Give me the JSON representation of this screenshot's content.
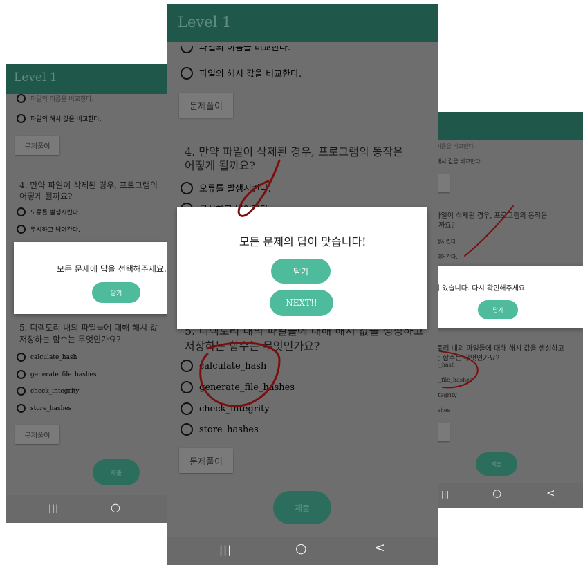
{
  "level_title": "Level 1",
  "options_prev": {
    "prev_a": "파일의 이름을 비교한다.",
    "prev_b": "파일의 해시 값을 비교한다."
  },
  "solve_label": "문제풀이",
  "q4": {
    "text_line1": "4. 만약 파일이 삭제된 경우, 프로그램의 동작은",
    "text_line2": "어떻게 될까요?",
    "text_short1": "4. 만약 파일이 삭제된 경우, 프로그램의",
    "opt1": "오류를 발생시킨다.",
    "opt2": "무시하고 넘어간다."
  },
  "q5": {
    "text_line1": "5. 디렉토리 내의 파일들에 대해 해시 값을 생성하고",
    "text_line2": "저장하는 함수는 무엇인가요?",
    "text_short1": "5. 디렉토리 내의 파일들에 대해 해시 값",
    "options": [
      "calculate_hash",
      "generate_file_hashes",
      "check_integrity",
      "store_hashes"
    ]
  },
  "submit_label": "제출",
  "dialogs": {
    "left_message": "모든 문제에 답을 선택해주세요.",
    "center_message": "모든 문제의 답이 맞습니다!",
    "right_message": "틀린 답이 있습니다. 다시 확인해주세요.",
    "close_label": "닫기",
    "next_label": "NEXT!!"
  },
  "nav": {
    "recents_glyph": "|||",
    "home_glyph": "○",
    "back_glyph": "<"
  },
  "colors": {
    "appbar": "#20574b",
    "dialog_button": "#4dbb9c",
    "scrim_bg": "#6e6e6e",
    "ink": "#7a0f10"
  }
}
